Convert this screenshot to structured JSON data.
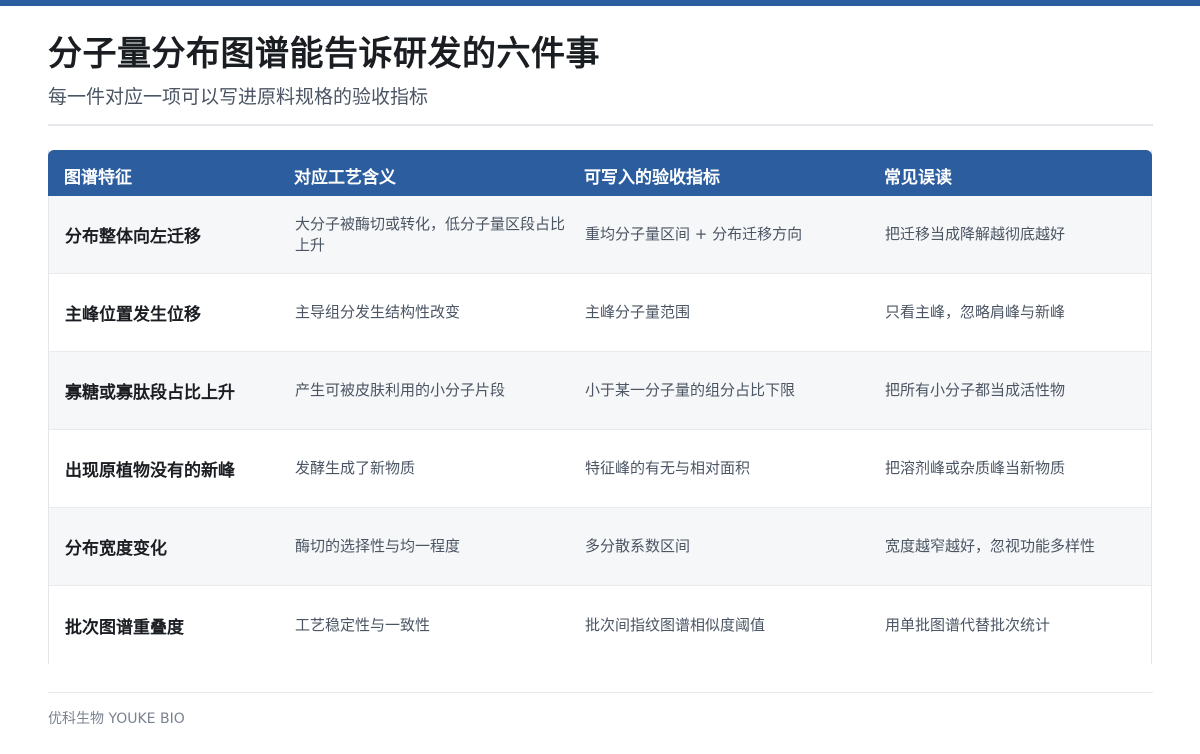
{
  "header": {
    "title": "分子量分布图谱能告诉研发的六件事",
    "subtitle": "每一件对应一项可以写进原料规格的验收指标"
  },
  "table": {
    "columns": [
      "图谱特征",
      "对应工艺含义",
      "可写入的验收指标",
      "常见误读"
    ],
    "rows": [
      [
        "分布整体向左迁移",
        "大分子被酶切或转化，低分子量区段占比上升",
        "重均分子量区间 + 分布迁移方向",
        "把迁移当成降解越彻底越好"
      ],
      [
        "主峰位置发生位移",
        "主导组分发生结构性改变",
        "主峰分子量范围",
        "只看主峰，忽略肩峰与新峰"
      ],
      [
        "寡糖或寡肽段占比上升",
        "产生可被皮肤利用的小分子片段",
        "小于某一分子量的组分占比下限",
        "把所有小分子都当成活性物"
      ],
      [
        "出现原植物没有的新峰",
        "发酵生成了新物质",
        "特征峰的有无与相对面积",
        "把溶剂峰或杂质峰当新物质"
      ],
      [
        "分布宽度变化",
        "酶切的选择性与均一程度",
        "多分散系数区间",
        "宽度越窄越好，忽视功能多样性"
      ],
      [
        "批次图谱重叠度",
        "工艺稳定性与一致性",
        "批次间指纹图谱相似度阈值",
        "用单批图谱代替批次统计"
      ]
    ]
  },
  "footer": {
    "brand": "优科生物 YOUKE BIO"
  },
  "colors": {
    "accent": "#2b5d9f",
    "row_alt": "#f6f7f9"
  }
}
